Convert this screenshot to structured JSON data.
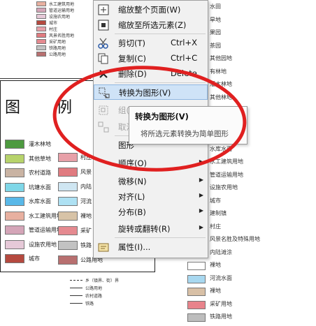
{
  "context_menu": {
    "items": [
      {
        "label": "缩放整个页面(W)",
        "shortcut": "",
        "icon": "zoom-page-icon"
      },
      {
        "label": "缩放至所选元素(Z)",
        "shortcut": "",
        "icon": "zoom-selection-icon"
      },
      {
        "label": "剪切(T)",
        "shortcut": "Ctrl+X",
        "icon": "scissors-icon"
      },
      {
        "label": "复制(C)",
        "shortcut": "Ctrl+C",
        "icon": "copy-icon"
      },
      {
        "label": "删除(D)",
        "shortcut": "Delete",
        "icon": "delete-x-icon"
      },
      {
        "label": "转换为图形(V)",
        "shortcut": "",
        "icon": "convert-graphics-icon",
        "highlighted": true
      },
      {
        "label": "组(",
        "shortcut": "",
        "icon": "group-icon",
        "disabled": true
      },
      {
        "label": "取消",
        "shortcut": "",
        "icon": "ungroup-icon",
        "disabled": true
      },
      {
        "label": "图形",
        "shortcut": "",
        "icon": ""
      },
      {
        "label": "顺序(O)",
        "shortcut": "",
        "icon": "",
        "submenu": true
      },
      {
        "label": "微移(N)",
        "shortcut": "",
        "icon": "",
        "submenu": true
      },
      {
        "label": "对齐(L)",
        "shortcut": "",
        "icon": "",
        "submenu": true
      },
      {
        "label": "分布(B)",
        "shortcut": "",
        "icon": "",
        "submenu": true
      },
      {
        "label": "旋转或翻转(R)",
        "shortcut": "",
        "icon": "",
        "submenu": true
      },
      {
        "label": "属性(I)...",
        "shortcut": "",
        "icon": "properties-icon"
      }
    ]
  },
  "tooltip": {
    "title": "转换为图形(V)",
    "description": "将所选元素转换为简单图形"
  },
  "legend_panel": {
    "title_left": "图",
    "title_right": "例",
    "items": [
      {
        "label": "灌木林地",
        "color": "#4d9a3f"
      },
      {
        "label": "其他草地",
        "color": "#b7d36b"
      },
      {
        "label": "农村道路",
        "color": "#c9b3a3"
      },
      {
        "label": "坑塘水面",
        "color": "#7fd7e8"
      },
      {
        "label": "水库水面",
        "color": "#59b8e8"
      },
      {
        "label": "水工建筑用地",
        "color": "#e8b0a0"
      },
      {
        "label": "管道运输用地",
        "color": "#d4a5b8"
      },
      {
        "label": "设施农用地",
        "color": "#e6c9d8"
      },
      {
        "label": "城市",
        "color": "#b5493f"
      }
    ],
    "items_col2": [
      {
        "label": "村庄",
        "color": "#e7a0a8"
      },
      {
        "label": "风景",
        "color": "#e07b80"
      },
      {
        "label": "内陆",
        "color": "#cfe6f2"
      },
      {
        "label": "河流",
        "color": "#aee1f3"
      },
      {
        "label": "裸地",
        "color": "#d7c3a7"
      },
      {
        "label": "采矿",
        "color": "#e58a90"
      },
      {
        "label": "铁路",
        "color": "#c2c2c2"
      },
      {
        "label": "公路用地",
        "color": "#b87070"
      }
    ]
  },
  "top_legend": [
    {
      "label": "水工建筑用地",
      "color": "#e8b0a0"
    },
    {
      "label": "管道运输用地",
      "color": "#d4a5b8"
    },
    {
      "label": "设施农用地",
      "color": "#e6c9d8"
    },
    {
      "label": "城市",
      "color": "#b5493f"
    },
    {
      "label": "村庄",
      "color": "#e7a0a8"
    },
    {
      "label": "风景名胜用地",
      "color": "#e07b80"
    },
    {
      "label": "采矿用地",
      "color": "#e58a90"
    },
    {
      "label": "铁路用地",
      "color": "#c2c2c2"
    },
    {
      "label": "公路用地",
      "color": "#b87070"
    }
  ],
  "right_list": [
    {
      "label": "水田",
      "color": ""
    },
    {
      "label": "旱地",
      "color": ""
    },
    {
      "label": "果园",
      "color": ""
    },
    {
      "label": "茶园",
      "color": ""
    },
    {
      "label": "其他园地",
      "color": ""
    },
    {
      "label": "有林地",
      "color": ""
    },
    {
      "label": "灌木林地",
      "color": ""
    },
    {
      "label": "其他林地",
      "color": ""
    },
    {
      "label": "其他草地",
      "color": ""
    },
    {
      "label": "农村道路",
      "color": ""
    },
    {
      "label": "坑塘水面",
      "color": ""
    },
    {
      "label": "水库水面",
      "color": ""
    },
    {
      "label": "水工建筑用地",
      "color": ""
    },
    {
      "label": "管道运输用地",
      "color": ""
    },
    {
      "label": "设施农用地",
      "color": ""
    },
    {
      "label": "城市",
      "color": ""
    },
    {
      "label": "建制镇",
      "color": ""
    },
    {
      "label": "村庄",
      "color": ""
    },
    {
      "label": "风景名胜及特殊用地",
      "color": ""
    },
    {
      "label": "内陆滩涂",
      "color": "#f4a6a6"
    },
    {
      "label": "裸地",
      "color": "#ffffff"
    },
    {
      "label": "河流水面",
      "color": "#a8d8f0"
    },
    {
      "label": "裸地",
      "color": "#d8c0a6"
    },
    {
      "label": "采矿用地",
      "color": "#e8838b"
    },
    {
      "label": "铁路用地",
      "color": "#bdbdbd"
    }
  ],
  "line_legend": [
    {
      "label": "乡（镇界、街）界",
      "style": "dash"
    },
    {
      "label": "公路用地",
      "style": "solid"
    },
    {
      "label": "农村道路",
      "style": "solid"
    },
    {
      "label": "铁路",
      "style": "solid"
    }
  ]
}
